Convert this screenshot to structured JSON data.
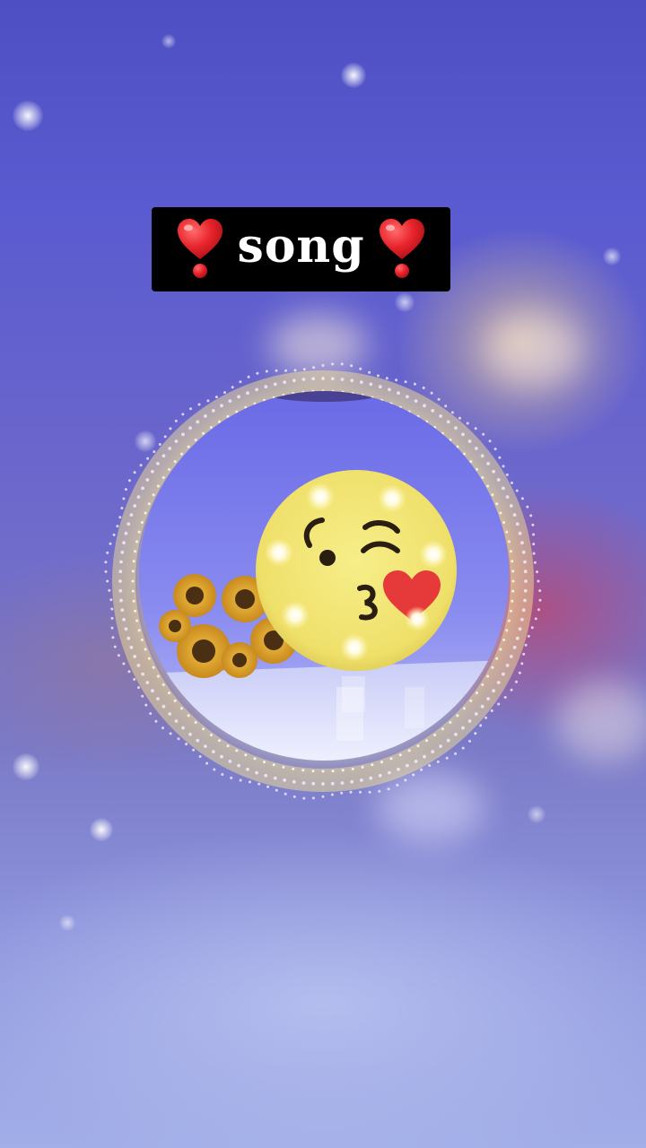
{
  "title": {
    "text": "song",
    "left_icon": "red-heart-exclamation-icon",
    "right_icon": "red-heart-exclamation-icon"
  },
  "player": {
    "album_art_icon": "kissing-face-emoji-lamp",
    "visualizer": "dotted-audio-ring"
  },
  "colors": {
    "banner_bg": "#000000",
    "title_text": "#ffffff",
    "heart_red": "#e8242c",
    "background_violet": "#5a5bd0",
    "emoji_yellow": "#f1e470"
  }
}
